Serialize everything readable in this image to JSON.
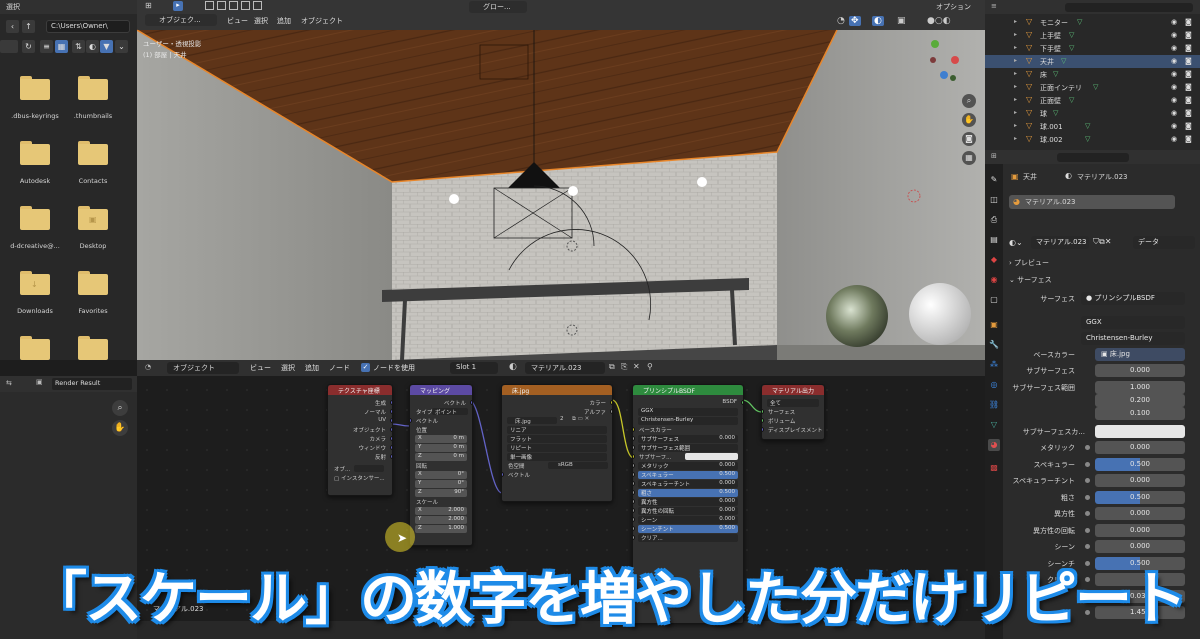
{
  "file_browser": {
    "header_label": "選択",
    "path": "C:\\Users\\Owner\\",
    "items": [
      {
        "label": ".dbus-keyrings",
        "mark": ""
      },
      {
        "label": ".thumbnails",
        "mark": ""
      },
      {
        "label": "Autodesk",
        "mark": ""
      },
      {
        "label": "Contacts",
        "mark": ""
      },
      {
        "label": "d-dcreative@...",
        "mark": ""
      },
      {
        "label": "Desktop",
        "mark": "▣"
      },
      {
        "label": "Downloads",
        "mark": "↓"
      },
      {
        "label": "Favorites",
        "mark": ""
      },
      {
        "label": "",
        "mark": ""
      },
      {
        "label": "",
        "mark": ""
      }
    ]
  },
  "image_editor": {
    "image_name": "Render Result"
  },
  "viewport": {
    "mode": "オブジェク...",
    "menus": [
      "ビュー",
      "選択",
      "追加",
      "オブジェクト"
    ],
    "info_view": "ユーザー・透視投影",
    "info_object": "(1) 部屋 | 天井",
    "transform_orientation": "グロー...",
    "options_label": "オプション",
    "colors": {
      "ceiling": "#5e3418",
      "wall": "#9a9a96",
      "floor": "#c6c4bf",
      "table": "#3e3e3e"
    }
  },
  "node_editor": {
    "mode": "オブジェクト",
    "menus": [
      "ビュー",
      "選択",
      "追加",
      "ノード"
    ],
    "use_nodes_label": "ノードを使用",
    "slot": "Slot 1",
    "material": "マテリアル.023",
    "footer_material": "マテリアル.023",
    "nodes": {
      "texcoord": {
        "title": "テクスチャ座標",
        "outputs": [
          "生成",
          "ノーマル",
          "UV",
          "オブジェクト",
          "カメラ",
          "ウィンドウ",
          "反射"
        ],
        "object_label": "オブ...",
        "instancer_label": "インスタンサー..."
      },
      "mapping": {
        "title": "マッピング",
        "output": "ベクトル",
        "type_label": "タイプ",
        "type_value": "ポイント",
        "vector_label": "ベクトル",
        "location_label": "位置",
        "location": [
          [
            "X",
            "0 m"
          ],
          [
            "Y",
            "0 m"
          ],
          [
            "Z",
            "0 m"
          ]
        ],
        "rotation_label": "回転",
        "rotation": [
          [
            "X",
            "0°"
          ],
          [
            "Y",
            "0°"
          ],
          [
            "Z",
            "90°"
          ]
        ],
        "scale_label": "スケール",
        "scale": [
          [
            "X",
            "2.000"
          ],
          [
            "Y",
            "2.000"
          ],
          [
            "Z",
            "1.000"
          ]
        ]
      },
      "image": {
        "title": "床.jpg",
        "outputs": [
          "カラー",
          "アルファ"
        ],
        "image_name": "床.jpg",
        "users": "2",
        "interpolation": "リニア",
        "projection": "フラット",
        "extension": "リピート",
        "source": "単一画像",
        "colorspace_label": "色空間",
        "colorspace_value": "sRGB",
        "vector_label": "ベクトル"
      },
      "bsdf": {
        "title": "プリンシプルBSDF",
        "output": "BSDF",
        "distribution": "GGX",
        "subsurface_method": "Christensen-Burley",
        "rows": [
          {
            "label": "ベースカラー",
            "value": "",
            "kind": "socket"
          },
          {
            "label": "サブサーフェス",
            "value": "0.000",
            "kind": "dark"
          },
          {
            "label": "サブサーフェス範囲",
            "value": "",
            "kind": "dark"
          },
          {
            "label": "サブサーフ...",
            "value": "",
            "kind": "white"
          },
          {
            "label": "メタリック",
            "value": "0.000",
            "kind": "dark"
          },
          {
            "label": "スペキュラー",
            "value": "0.500",
            "kind": "blue"
          },
          {
            "label": "スペキュラーチント",
            "value": "0.000",
            "kind": "dark"
          },
          {
            "label": "粗さ",
            "value": "0.500",
            "kind": "blue"
          },
          {
            "label": "異方性",
            "value": "0.000",
            "kind": "dark"
          },
          {
            "label": "異方性の回転",
            "value": "0.000",
            "kind": "dark"
          },
          {
            "label": "シーン",
            "value": "0.000",
            "kind": "dark"
          },
          {
            "label": "シーンチント",
            "value": "0.500",
            "kind": "blue"
          },
          {
            "label": "クリア...",
            "value": "",
            "kind": "dark"
          }
        ]
      },
      "output": {
        "title": "マテリアル出力",
        "target": "全て",
        "inputs": [
          "サーフェス",
          "ボリューム",
          "ディスプレイスメント"
        ]
      }
    }
  },
  "outliner": {
    "rows": [
      {
        "name": "モニター",
        "selected": false
      },
      {
        "name": "上手壁",
        "selected": false
      },
      {
        "name": "下手壁",
        "selected": false
      },
      {
        "name": "天井",
        "selected": true
      },
      {
        "name": "床",
        "selected": false
      },
      {
        "name": "正面インテリ",
        "selected": false
      },
      {
        "name": "正面壁",
        "selected": false
      },
      {
        "name": "球",
        "selected": false
      },
      {
        "name": "球.001",
        "selected": false
      },
      {
        "name": "球.002",
        "selected": false
      }
    ]
  },
  "properties": {
    "object_name": "天井",
    "material_name": "マテリアル.023",
    "slot_material": "マテリアル.023",
    "data_dropdown": "データ",
    "preview_label": "プレビュー",
    "surface_panel_label": "サーフェス",
    "surface_label": "サーフェス",
    "surface_value": "プリンシプルBSDF",
    "distribution": "GGX",
    "subsurface_method": "Christensen-Burley",
    "base_color_label": "ベースカラー",
    "base_color_value": "床.jpg",
    "subsurface_label": "サブサーフェス",
    "subsurface_value": "0.000",
    "subsurface_radius_label": "サブサーフェス範囲",
    "subsurface_radius": [
      "1.000",
      "0.200",
      "0.100"
    ],
    "subsurface_color_label": "サブサーフェスカ...",
    "params": [
      {
        "label": "メタリック",
        "value": "0.000",
        "fill": 0
      },
      {
        "label": "スペキュラー",
        "value": "0.500",
        "fill": 0.5
      },
      {
        "label": "スペキュラーチント",
        "value": "0.000",
        "fill": 0
      },
      {
        "label": "粗さ",
        "value": "0.500",
        "fill": 0.5
      },
      {
        "label": "異方性",
        "value": "0.000",
        "fill": 0
      },
      {
        "label": "異方性の回転",
        "value": "0.000",
        "fill": 0
      },
      {
        "label": "シーン",
        "value": "0.000",
        "fill": 0
      },
      {
        "label": "シーンチ",
        "value": "0.500",
        "fill": 0.5
      },
      {
        "label": "クリアコ",
        "value": "",
        "fill": 0
      },
      {
        "label": "",
        "value": "0.030",
        "fill": 0
      },
      {
        "label": "",
        "value": "1.450",
        "fill": 0
      }
    ]
  },
  "caption": "「スケール」の数字を増やした分だけリピート"
}
